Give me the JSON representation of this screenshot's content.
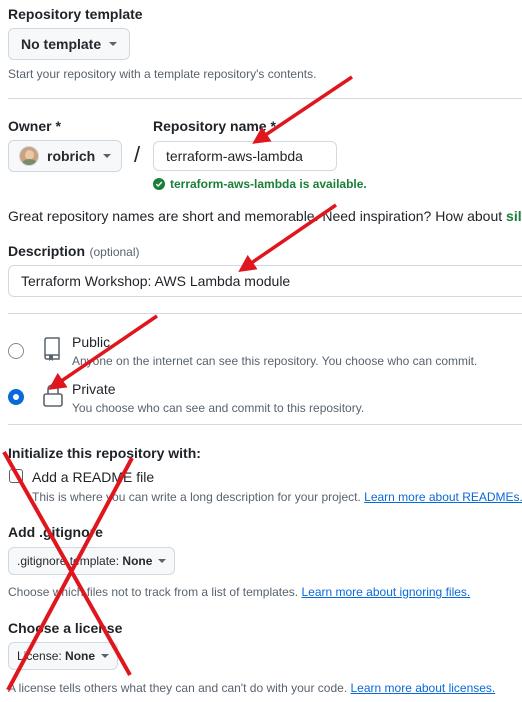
{
  "template": {
    "label": "Repository template",
    "button": "No template",
    "help": "Start your repository with a template repository's contents."
  },
  "owner": {
    "label": "Owner *",
    "value": "robrich",
    "separator": "/"
  },
  "repo_name": {
    "label": "Repository name *",
    "value": "terraform-aws-lambda",
    "availability": "terraform-aws-lambda is available."
  },
  "inspiration": {
    "text": "Great repository names are short and memorable. Need inspiration? How about ",
    "suggestion": "silv"
  },
  "description": {
    "label": "Description",
    "optional": "(optional)",
    "value": "Terraform Workshop: AWS Lambda module"
  },
  "visibility": {
    "public_title": "Public",
    "public_desc": "Anyone on the internet can see this repository. You choose who can commit.",
    "private_title": "Private",
    "private_desc": "You choose who can see and commit to this repository.",
    "selected": "private"
  },
  "initialize": {
    "heading": "Initialize this repository with:",
    "readme_label": "Add a README file",
    "readme_desc": "This is where you can write a long description for your project. ",
    "readme_link": "Learn more about READMEs."
  },
  "gitignore": {
    "heading": "Add .gitignore",
    "button_prefix": ".gitignore template: ",
    "button_value": "None",
    "desc": "Choose which files not to track from a list of templates. ",
    "link": "Learn more about ignoring files."
  },
  "license": {
    "heading": "Choose a license",
    "button_prefix": "License: ",
    "button_value": "None",
    "desc": "A license tells others what they can and can't do with your code. ",
    "link": "Learn more about licenses."
  },
  "colors": {
    "annotation": "#e0161e",
    "success": "#1a7f37",
    "accent": "#0969da"
  }
}
